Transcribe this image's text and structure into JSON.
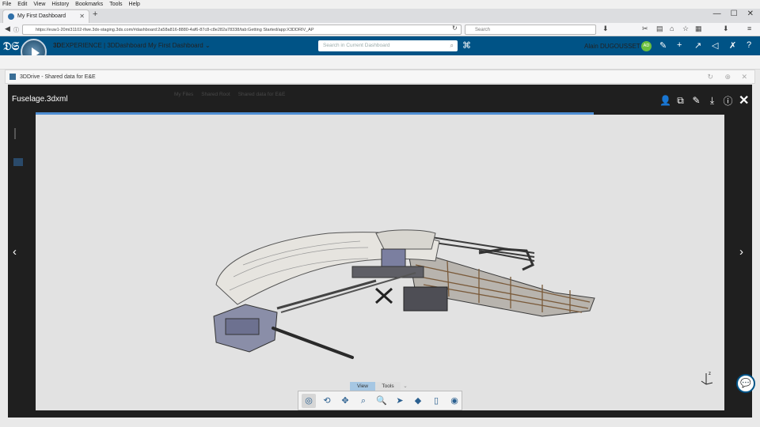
{
  "browser": {
    "menu": [
      "File",
      "Edit",
      "View",
      "History",
      "Bookmarks",
      "Tools",
      "Help"
    ],
    "tab_title": "My First Dashboard",
    "url": "https://euw1-20mi31102-ifwe.3dx-staging.3ds.com/#dashboard:2a58a816-8880-4af6-87c8-c8e282a78338/tab:Getting Started/app:X3DDRIV_AP",
    "search_placeholder": "Search",
    "new_tab": "+"
  },
  "header": {
    "brand_3d": "3D",
    "brand_rest": "EXPERIENCE | 3DDashboard",
    "dashboard_name": "My First Dashboard",
    "search_placeholder": "Search in Current Dashboard",
    "user_name": "Alain DUGOUSSET",
    "user_initials": "AD"
  },
  "widget": {
    "title": "3DDrive - Shared data for E&E"
  },
  "ghost": {
    "items": [
      "My Files",
      "Shared Root",
      "Shared data for E&E"
    ]
  },
  "viewer": {
    "filename": "Fuselage.3dxml",
    "prev_arrow": "‹",
    "next_arrow": "›",
    "tabs": [
      "View",
      "Tools"
    ],
    "progress_fraction": 0.81
  },
  "icons": {
    "header": [
      "compass-icon",
      "tag-icon",
      "feather-icon",
      "plus-icon",
      "share-icon",
      "broadcast-icon",
      "tools-icon",
      "help-icon"
    ],
    "viewer": [
      "add-person-icon",
      "copy-icon",
      "edit-icon",
      "download-icon",
      "info-icon",
      "close-icon"
    ],
    "toolbar": [
      "fit-all-icon",
      "rotate-icon",
      "pan-icon",
      "zoom-box-icon",
      "zoom-icon",
      "select-icon",
      "view-cube-icon",
      "section-icon",
      "visibility-icon"
    ]
  },
  "colors": {
    "header_blue": "#005386",
    "viewer_dark": "#1f1f1f",
    "progress_blue": "#4f8fd4",
    "canvas_bg": "#e2e2e2"
  }
}
